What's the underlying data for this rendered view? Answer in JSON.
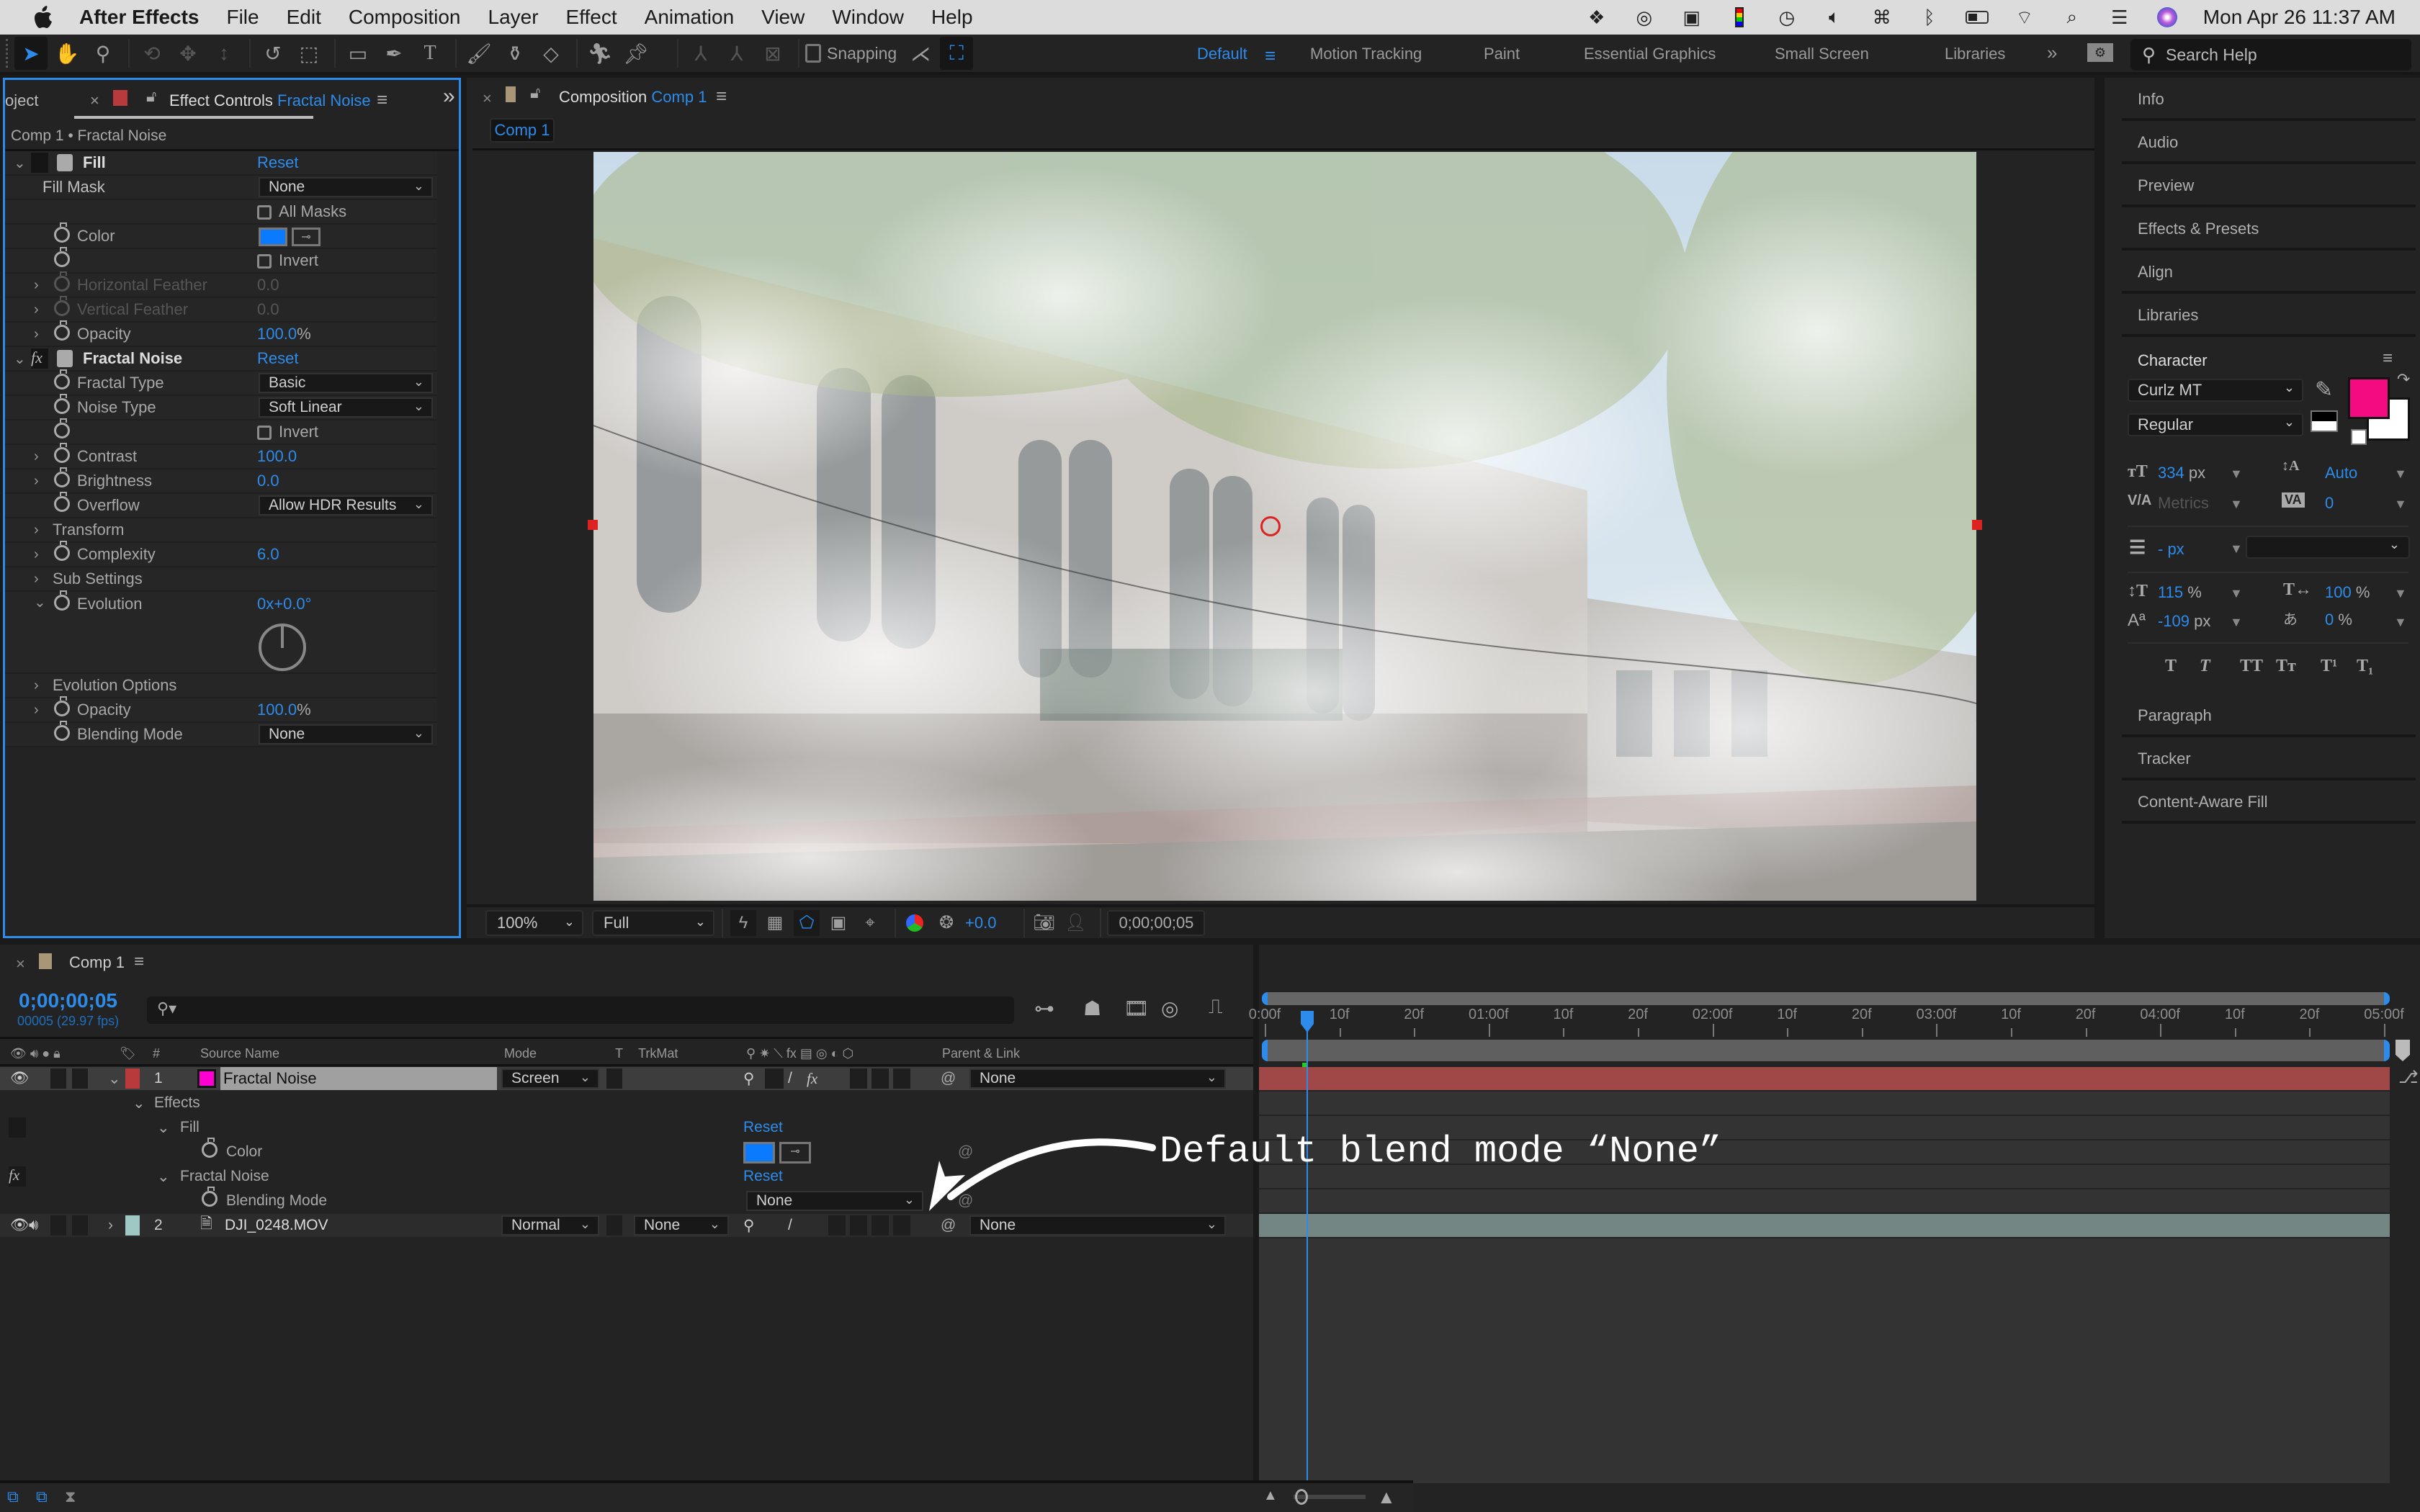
{
  "menubar": {
    "app_name": "After Effects",
    "items": [
      "File",
      "Edit",
      "Composition",
      "Layer",
      "Effect",
      "Animation",
      "View",
      "Window",
      "Help"
    ],
    "clock": "Mon Apr 26  11:37 AM"
  },
  "toolbar": {
    "snapping_label": "Snapping",
    "workspaces": [
      "Default",
      "Motion Tracking",
      "Paint",
      "Essential Graphics",
      "Small Screen",
      "Libraries"
    ],
    "active_workspace": "Default",
    "search_placeholder": "Search Help"
  },
  "effect_controls": {
    "prev_tab": "oject",
    "tab_prefix": "Effect Controls",
    "tab_layer": "Fractal Noise",
    "breadcrumb": "Comp 1 • Fractal Noise",
    "fill": {
      "name": "Fill",
      "reset": "Reset",
      "fill_mask_label": "Fill Mask",
      "fill_mask_value": "None",
      "all_masks_label": "All Masks",
      "color_label": "Color",
      "color_value": "#0a7bff",
      "invert_label": "Invert",
      "h_feather_label": "Horizontal Feather",
      "h_feather_value": "0.0",
      "v_feather_label": "Vertical Feather",
      "v_feather_value": "0.0",
      "opacity_label": "Opacity",
      "opacity_value": "100.0",
      "opacity_unit": "%"
    },
    "fractal_noise": {
      "name": "Fractal Noise",
      "reset": "Reset",
      "fractal_type_label": "Fractal Type",
      "fractal_type_value": "Basic",
      "noise_type_label": "Noise Type",
      "noise_type_value": "Soft Linear",
      "invert_label": "Invert",
      "contrast_label": "Contrast",
      "contrast_value": "100.0",
      "brightness_label": "Brightness",
      "brightness_value": "0.0",
      "overflow_label": "Overflow",
      "overflow_value": "Allow HDR Results",
      "transform_label": "Transform",
      "complexity_label": "Complexity",
      "complexity_value": "6.0",
      "sub_settings_label": "Sub Settings",
      "evolution_label": "Evolution",
      "evolution_value": "0x+0.0°",
      "evolution_options_label": "Evolution Options",
      "opacity_label": "Opacity",
      "opacity_value": "100.0",
      "opacity_unit": "%",
      "blending_mode_label": "Blending Mode",
      "blending_mode_value": "None"
    }
  },
  "composition": {
    "tab_prefix": "Composition",
    "tab_comp": "Comp 1",
    "subtab": "Comp 1",
    "zoom": "100%",
    "resolution": "Full",
    "exposure": "+0.0",
    "timecode": "0;00;00;05"
  },
  "right_panels": {
    "items": [
      "Info",
      "Audio",
      "Preview",
      "Effects & Presets",
      "Align",
      "Libraries"
    ],
    "character": {
      "title": "Character",
      "font_family": "Curlz MT",
      "font_style": "Regular",
      "fill_color": "#f40b82",
      "font_size": "334",
      "font_size_unit": "px",
      "leading": "Auto",
      "kerning": "Metrics",
      "tracking": "0",
      "stroke_width": "- px",
      "vertical_scale": "115",
      "horizontal_scale": "100",
      "baseline_shift": "-109",
      "baseline_unit": "px",
      "tsume": "0",
      "percent": "%"
    },
    "lower_items": [
      "Paragraph",
      "Tracker",
      "Content-Aware Fill"
    ]
  },
  "timeline": {
    "tab": "Comp 1",
    "timecode": "0;00;00;05",
    "frame_info": "00005 (29.97 fps)",
    "columns": {
      "num": "#",
      "source_name": "Source Name",
      "mode": "Mode",
      "t": "T",
      "trkmat": "TrkMat",
      "parent": "Parent & Link"
    },
    "ruler": [
      "0:00f",
      "10f",
      "20f",
      "01:00f",
      "10f",
      "20f",
      "02:00f",
      "10f",
      "20f",
      "03:00f",
      "10f",
      "20f",
      "04:00f",
      "10f",
      "20f",
      "05:00f"
    ],
    "layers": [
      {
        "num": "1",
        "name": "Fractal Noise",
        "mode": "Screen",
        "trkmat": "",
        "parent": "None",
        "label_color": "#b83a3a",
        "swatch": "#ff00d2"
      },
      {
        "num": "2",
        "name": "DJI_0248.MOV",
        "mode": "Normal",
        "trkmat": "None",
        "parent": "None",
        "label_color": "#9fc8c5"
      }
    ],
    "sub": {
      "effects_label": "Effects",
      "fill_label": "Fill",
      "fill_reset": "Reset",
      "color_label": "Color",
      "fractal_label": "Fractal Noise",
      "fractal_reset": "Reset",
      "blending_label": "Blending Mode",
      "blending_value": "None"
    },
    "annotation": "Default blend mode “None”"
  }
}
